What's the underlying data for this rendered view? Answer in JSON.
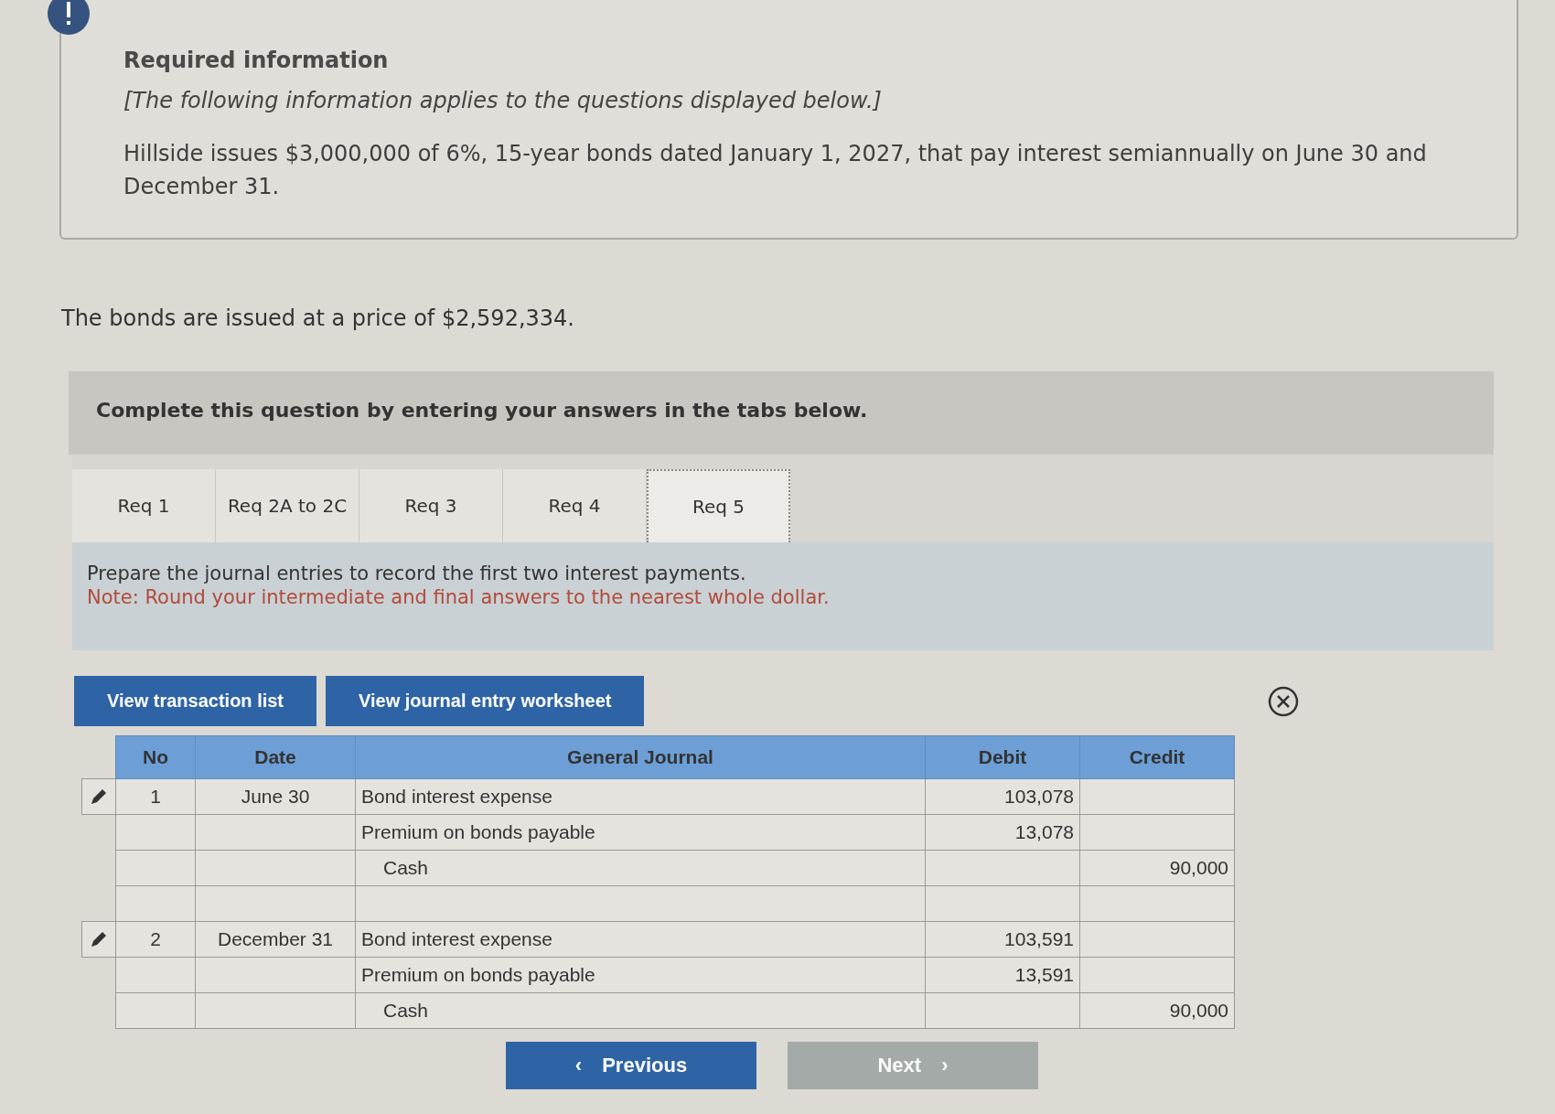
{
  "info": {
    "title": "Required information",
    "note": "[The following information applies to the questions displayed below.]",
    "body": "Hillside issues $3,000,000 of 6%, 15-year bonds dated January 1, 2027, that pay interest semiannually on June 30 and December 31."
  },
  "statement": "The bonds are issued at a price of $2,592,334.",
  "banner": "Complete this question by entering your answers in the tabs below.",
  "tabs": [
    {
      "label": "Req 1",
      "selected": false
    },
    {
      "label": "Req 2A to 2C",
      "selected": false
    },
    {
      "label": "Req 3",
      "selected": false
    },
    {
      "label": "Req 4",
      "selected": false
    },
    {
      "label": "Req 5",
      "selected": true
    }
  ],
  "instructions": {
    "text": "Prepare the journal entries to record the first two interest payments.",
    "note": "Note: Round your intermediate and final answers to the nearest whole dollar."
  },
  "buttons": [
    "View transaction list",
    "View journal entry worksheet"
  ],
  "journal": {
    "columns": [
      "No",
      "Date",
      "General Journal",
      "Debit",
      "Credit"
    ],
    "rows": [
      {
        "edit": true,
        "no": "1",
        "date": "June 30",
        "account": "Bond interest expense",
        "indented": false,
        "debit": "103,078",
        "credit": ""
      },
      {
        "edit": false,
        "no": "",
        "date": "",
        "account": "Premium on bonds payable",
        "indented": false,
        "debit": "13,078",
        "credit": ""
      },
      {
        "edit": false,
        "no": "",
        "date": "",
        "account": "Cash",
        "indented": true,
        "debit": "",
        "credit": "90,000"
      },
      {
        "edit": false,
        "no": "",
        "date": "",
        "account": "",
        "debit": "",
        "credit": ""
      },
      {
        "edit": true,
        "no": "2",
        "date": "December 31",
        "account": "Bond interest expense",
        "indented": false,
        "debit": "103,591",
        "credit": ""
      },
      {
        "edit": false,
        "no": "",
        "date": "",
        "account": "Premium on bonds payable",
        "indented": false,
        "debit": "13,591",
        "credit": ""
      },
      {
        "edit": false,
        "no": "",
        "date": "",
        "account": "Cash",
        "indented": true,
        "debit": "",
        "credit": "90,000"
      }
    ]
  },
  "nav": [
    {
      "label": "Previous",
      "arrow": "‹",
      "disabled": false
    },
    {
      "label": "Next",
      "arrow": "›",
      "disabled": true
    }
  ]
}
